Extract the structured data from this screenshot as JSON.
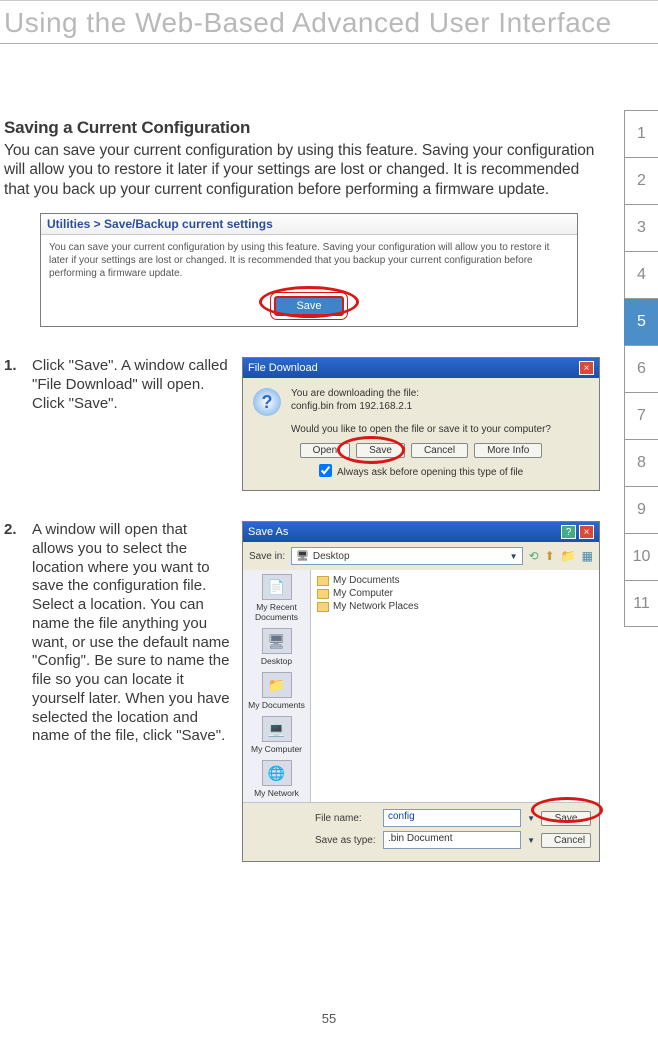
{
  "page_title": "Using the Web-Based Advanced User Interface",
  "page_number": "55",
  "side_tabs": [
    "1",
    "2",
    "3",
    "4",
    "5",
    "6",
    "7",
    "8",
    "9",
    "10",
    "11"
  ],
  "active_tab_index": 4,
  "section_heading": "Saving a Current Configuration",
  "section_body": "You can save your current configuration by using this feature. Saving your configuration will allow you to restore it later if your settings are lost or changed. It is recommended that you back up your current configuration before performing a firmware update.",
  "util_panel": {
    "title": "Utilities > Save/Backup current settings",
    "body": "You can save your current configuration by using this feature. Saving your configuration will allow you to restore it later if your settings are lost or changed. It is recommended that you backup your current configuration before performing a firmware update.",
    "save_label": "Save"
  },
  "steps": [
    {
      "num": "1.",
      "text": "Click \"Save\". A window called \"File Download\" will open. Click \"Save\"."
    },
    {
      "num": "2.",
      "text": "A window will open that allows you to select the location where you want to save the configuration file. Select a location. You can name the file anything you want, or use the default name \"Config\". Be sure to name the file so you can locate it yourself later. When you have selected the location and name of the file, click \"Save\"."
    }
  ],
  "file_download": {
    "title": "File Download",
    "line1": "You are downloading the file:",
    "line2": "config.bin from 192.168.2.1",
    "question": "Would you like to open the file or save it to your computer?",
    "btn_open": "Open",
    "btn_save": "Save",
    "btn_cancel": "Cancel",
    "btn_more": "More Info",
    "checkbox": "Always ask before opening this type of file"
  },
  "save_as": {
    "title": "Save As",
    "save_in_label": "Save in:",
    "save_in_value": "Desktop",
    "places": [
      "My Recent Documents",
      "Desktop",
      "My Documents",
      "My Computer",
      "My Network"
    ],
    "listing": [
      "My Documents",
      "My Computer",
      "My Network Places"
    ],
    "file_name_label": "File name:",
    "file_name_value": "config",
    "save_type_label": "Save as type:",
    "save_type_value": ".bin Document",
    "btn_save": "Save",
    "btn_cancel": "Cancel"
  }
}
